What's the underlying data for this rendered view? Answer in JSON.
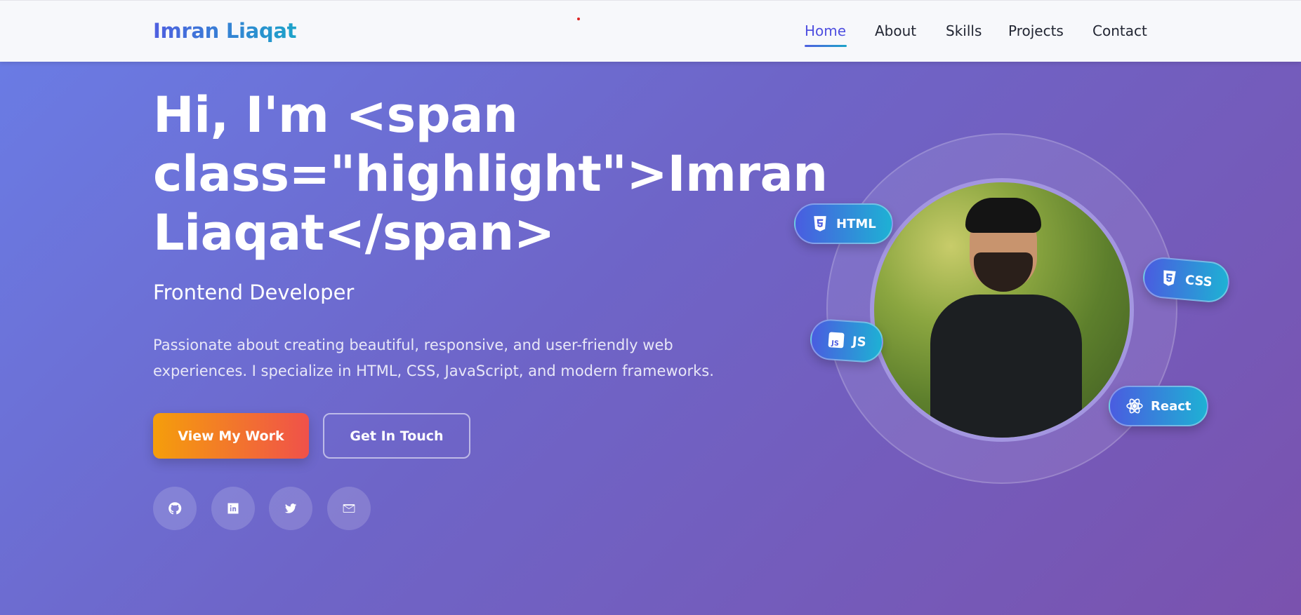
{
  "nav": {
    "brand": "Imran Liaqat",
    "links": [
      "Home",
      "About",
      "Skills",
      "Projects",
      "Contact"
    ]
  },
  "hero": {
    "headline": "Hi, I'm <span class=\"highlight\">Imran Liaqat</span>",
    "role": "Frontend Developer",
    "description": "Passionate about creating beautiful, responsive, and user-friendly web experiences. I specialize in HTML, CSS, JavaScript, and modern frameworks.",
    "primary_button": "View My Work",
    "secondary_button": "Get In Touch",
    "social_icons": [
      "github-icon",
      "linkedin-icon",
      "twitter-icon",
      "envelope-icon"
    ]
  },
  "tech_badges": [
    "HTML",
    "CSS",
    "JS",
    "React"
  ],
  "colors": {
    "accent": "#4f4fe0",
    "brand_gradient_start": "#4f5fe0",
    "brand_gradient_end": "#1ca3c9",
    "cta_gradient_start": "#f59e0b",
    "cta_gradient_end": "#f0514a"
  }
}
